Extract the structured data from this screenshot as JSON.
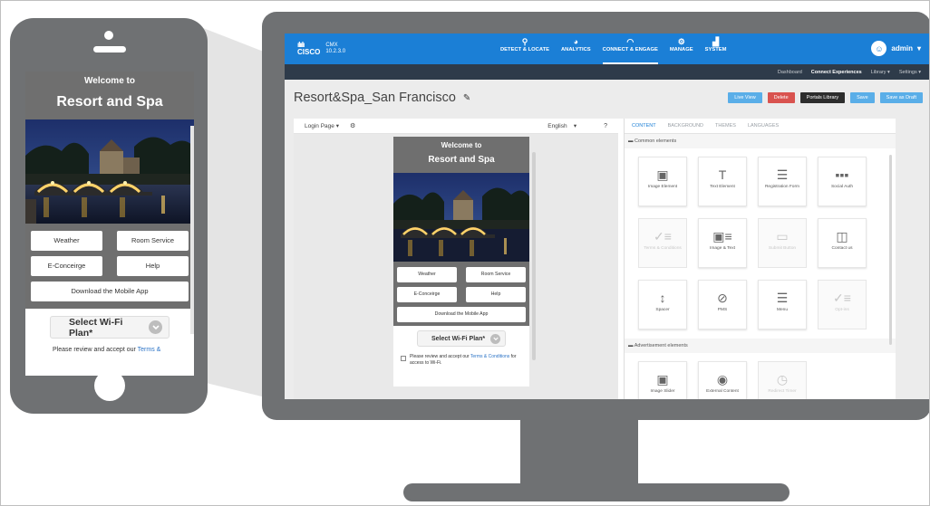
{
  "colors": {
    "brand_blue": "#1b7fd6",
    "dark_nav": "#2e3b4a",
    "device_gray": "#6f7173",
    "live_view": "#5aaee8",
    "delete_red": "#d9534f",
    "portals_dark": "#2d2d2d"
  },
  "phone": {
    "welcome": "Welcome to",
    "resort": "Resort and Spa",
    "buttons": {
      "weather": "Weather",
      "room_service": "Room Service",
      "concierge": "E-Conceirge",
      "help": "Help",
      "download": "Download the Mobile App"
    },
    "select_plan": "Select Wi-Fi Plan*",
    "terms_prefix": "Please review and accept our ",
    "terms_link": "Terms &"
  },
  "app": {
    "logo": {
      "brand": "CISCO",
      "product": "CMX",
      "version": "10.2.3.0"
    },
    "nav": [
      {
        "label": "DETECT & LOCATE",
        "icon": "location-pin-icon",
        "glyph": "⚲"
      },
      {
        "label": "ANALYTICS",
        "icon": "analytics-icon",
        "glyph": "◕"
      },
      {
        "label": "CONNECT & ENGAGE",
        "icon": "wifi-icon",
        "glyph": "◠"
      },
      {
        "label": "MANAGE",
        "icon": "manage-icon",
        "glyph": "⚙"
      },
      {
        "label": "SYSTEM",
        "icon": "system-icon",
        "glyph": "▟"
      }
    ],
    "user": {
      "name": "admin",
      "caret": "▾"
    },
    "subnav": [
      "Dashboard",
      "Connect Experiences",
      "Library ▾",
      "Settings ▾"
    ],
    "page_title": "Resort&Spa_San Francisco",
    "actions": {
      "live_view": "Live View",
      "delete": "Delete",
      "portals_library": "Portals Library",
      "save": "Save",
      "save_draft": "Save as Draft"
    },
    "preview": {
      "page_select": "Login Page",
      "language": "English",
      "welcome": "Welcome to",
      "resort": "Resort and Spa",
      "buttons": {
        "weather": "Weather",
        "room_service": "Room Service",
        "concierge": "E-Conceirge",
        "help": "Help",
        "download": "Download the Mobile App"
      },
      "select_plan": "Select Wi-Fi Plan*",
      "terms_prefix": "Please review and accept our ",
      "terms_link": "Terms & Conditions",
      "terms_suffix": " for access to Wi-Fi."
    },
    "tabs": [
      "CONTENT",
      "BACKGROUND",
      "THEMES",
      "LANGUAGES"
    ],
    "common_section": "Common elements",
    "common_elements": [
      {
        "label": "Image Element",
        "glyph": "▣"
      },
      {
        "label": "Text Element",
        "glyph": "T"
      },
      {
        "label": "Registration Form",
        "glyph": "☰"
      },
      {
        "label": "Social Auth",
        "glyph": "▪▪▪"
      },
      {
        "label": "Terms & Conditions",
        "glyph": "✓≡",
        "dim": true
      },
      {
        "label": "Image & Text",
        "glyph": "▣≡"
      },
      {
        "label": "Submit Button",
        "glyph": "▭",
        "dim": true
      },
      {
        "label": "Contact us",
        "glyph": "◫"
      },
      {
        "label": "Spacer",
        "glyph": "↕"
      },
      {
        "label": "PMS",
        "glyph": "⊘"
      },
      {
        "label": "Menu",
        "glyph": "☰"
      },
      {
        "label": "Opt-ins",
        "glyph": "✓≡",
        "dim": true
      }
    ],
    "ads_section": "Advertisement elements",
    "ads_elements": [
      {
        "label": "Image Slider",
        "glyph": "▣"
      },
      {
        "label": "External Content",
        "glyph": "◉"
      },
      {
        "label": "Redirect Timer",
        "glyph": "◷",
        "dim": true
      }
    ]
  }
}
